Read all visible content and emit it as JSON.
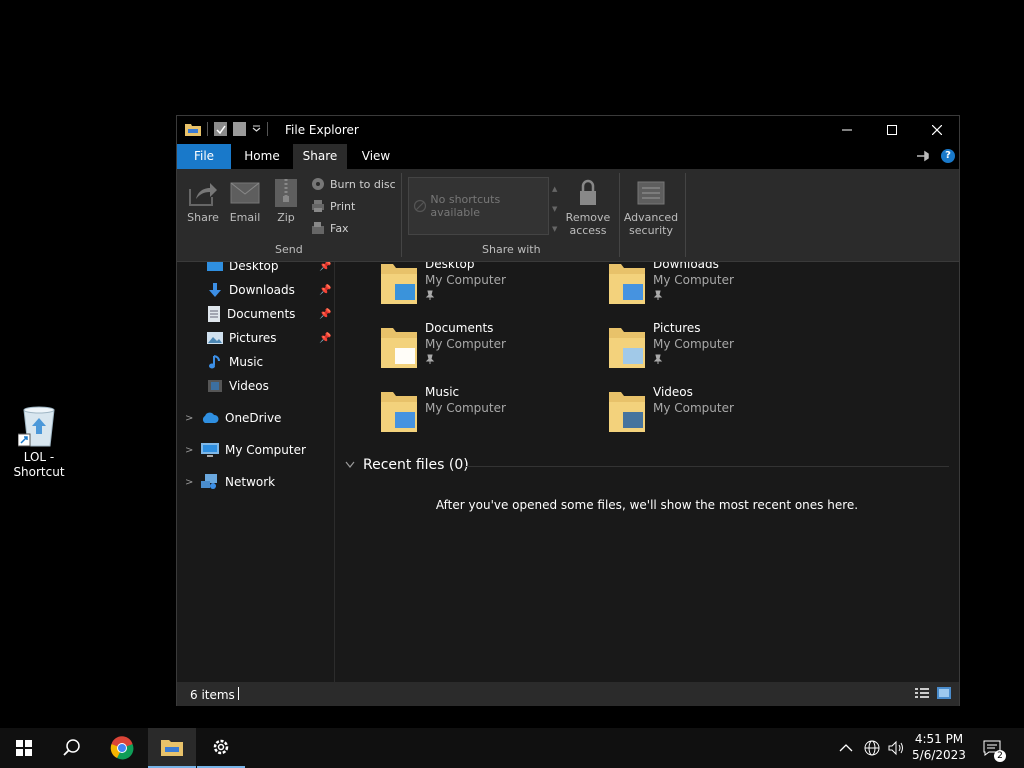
{
  "desktop": {
    "recycle_icon": "recycle-bin-icon",
    "shortcut_label": "LOL -\nShortcut"
  },
  "window": {
    "title": "File Explorer",
    "tabs": {
      "file": "File",
      "home": "Home",
      "share": "Share",
      "view": "View"
    },
    "ribbon": {
      "share": "Share",
      "email": "Email",
      "zip": "Zip",
      "burn": "Burn to disc",
      "print": "Print",
      "fax": "Fax",
      "send_group": "Send",
      "no_shortcuts": "No shortcuts available",
      "remove_access": "Remove\naccess",
      "advanced_security": "Advanced\nsecurity",
      "share_with_group": "Share with"
    },
    "nav": {
      "desktop": "Desktop",
      "downloads": "Downloads",
      "documents": "Documents",
      "pictures": "Pictures",
      "music": "Music",
      "videos": "Videos",
      "onedrive": "OneDrive",
      "my_computer": "My Computer",
      "network": "Network"
    },
    "folders": [
      {
        "name": "Desktop",
        "location": "My Computer",
        "pinned": true
      },
      {
        "name": "Downloads",
        "location": "My Computer",
        "pinned": true
      },
      {
        "name": "Documents",
        "location": "My Computer",
        "pinned": true
      },
      {
        "name": "Pictures",
        "location": "My Computer",
        "pinned": true
      },
      {
        "name": "Music",
        "location": "My Computer",
        "pinned": false
      },
      {
        "name": "Videos",
        "location": "My Computer",
        "pinned": false
      }
    ],
    "recent_header": "Recent files (0)",
    "recent_empty": "After you've opened some files, we'll show the most recent ones here.",
    "status_count": "6 items"
  },
  "taskbar": {
    "time": "4:51 PM",
    "date": "5/6/2023",
    "notif_count": "2"
  },
  "colors": {
    "accent": "#1979ca",
    "folder": "#e8c26a",
    "ribbon_bg": "#2b2b2b",
    "window_bg": "#191919"
  }
}
